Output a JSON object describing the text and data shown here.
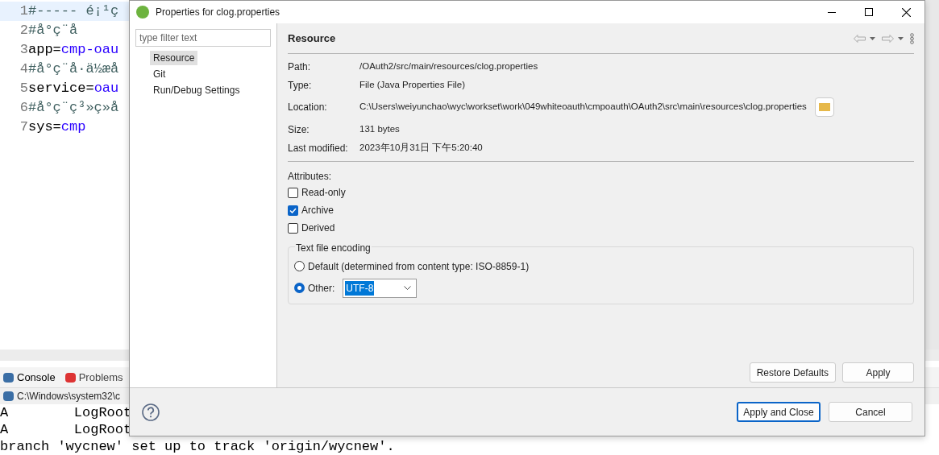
{
  "editor": {
    "lines": [
      {
        "number": "1",
        "kind": "comment",
        "text": "#----- é¡¹ç"
      },
      {
        "number": "2",
        "kind": "comment",
        "text": "#å°ç¨å"
      },
      {
        "number": "3",
        "kind": "entry",
        "key": "app=",
        "value": "cmp-oau"
      },
      {
        "number": "4",
        "kind": "comment",
        "text": "#å°ç¨å·ä½æå"
      },
      {
        "number": "5",
        "kind": "entry",
        "key": "service=",
        "value": "oau"
      },
      {
        "number": "6",
        "kind": "comment",
        "text": "#å°ç¨ç³»ç»å"
      },
      {
        "number": "7",
        "kind": "entry",
        "key": "sys=",
        "value": "cmp"
      }
    ]
  },
  "bottom_tabs": [
    {
      "label": "Console",
      "selected": true
    },
    {
      "label": "Problems",
      "selected": false
    }
  ],
  "console": {
    "title": "C:\\Windows\\system32\\c",
    "lines": [
      "A        LogRoot",
      "A        LogRoot",
      "branch 'wycnew' set up to track 'origin/wycnew'."
    ]
  },
  "dialog": {
    "title": "Properties for clog.properties",
    "filter": {
      "placeholder": "type filter text"
    },
    "pages": [
      {
        "label": "Resource",
        "selected": true
      },
      {
        "label": "Git",
        "selected": false
      },
      {
        "label": "Run/Debug Settings",
        "selected": false
      }
    ],
    "page_title": "Resource",
    "properties": [
      {
        "label": "Path:",
        "value": "/OAuth2/src/main/resources/clog.properties"
      },
      {
        "label": "Type:",
        "value": "File  (Java Properties File)"
      },
      {
        "label": "Location:",
        "value": "C:\\Users\\weiyunchao\\wyc\\workset\\work\\049whiteoauth\\cmpoauth\\OAuth2\\src\\main\\resources\\clog.properties"
      },
      {
        "label": "Size:",
        "value": "131  bytes"
      },
      {
        "label": "Last modified:",
        "value": "2023年10月31日 下午5:20:40"
      }
    ],
    "attributes_label": "Attributes:",
    "attributes": [
      {
        "label": "Read-only",
        "checked": false
      },
      {
        "label": "Archive",
        "checked": true
      },
      {
        "label": "Derived",
        "checked": false
      }
    ],
    "encoding": {
      "title": "Text file encoding",
      "options": [
        {
          "label": "Default (determined from content type: ISO-8859-1)",
          "selected": false
        },
        {
          "label": "Other:",
          "selected": true
        }
      ],
      "value": "UTF-8"
    },
    "page_buttons": [
      "Restore Defaults",
      "Apply"
    ],
    "buttons": [
      {
        "label": "Apply and Close",
        "default": true
      },
      {
        "label": "Cancel",
        "default": false
      }
    ]
  }
}
